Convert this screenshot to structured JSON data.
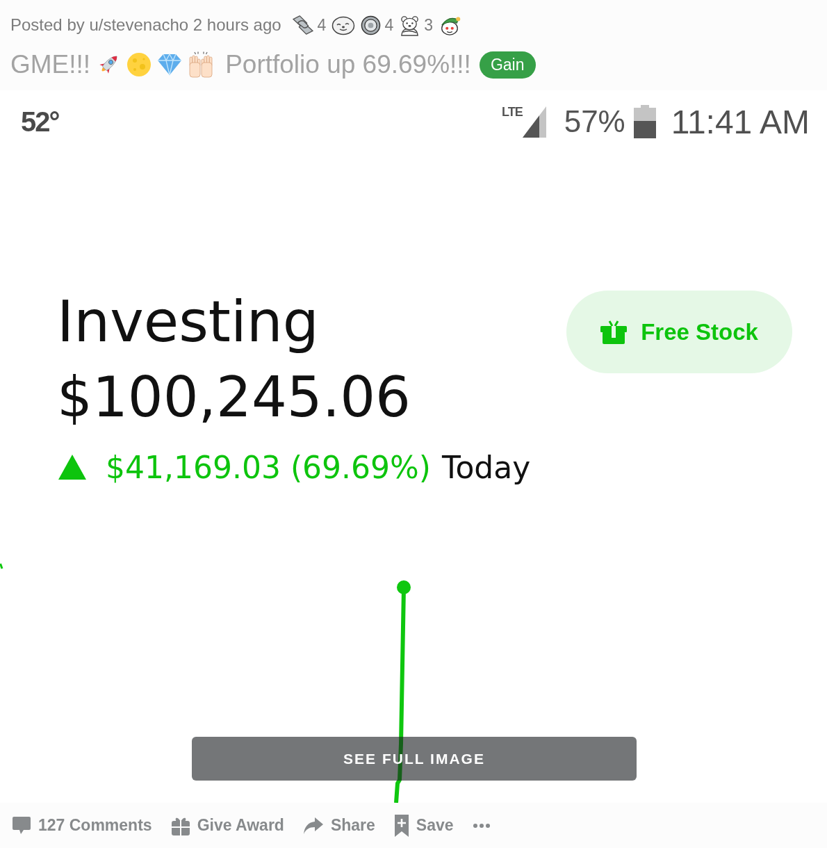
{
  "post": {
    "meta": "Posted by u/stevenacho 2 hours ago",
    "awards": [
      {
        "kind": "handshake",
        "count": "4"
      },
      {
        "kind": "seal"
      },
      {
        "kind": "silver",
        "count": "4"
      },
      {
        "kind": "bear",
        "count": "3"
      },
      {
        "kind": "elf"
      }
    ]
  },
  "title": {
    "lead": "GME!!!",
    "emojis": [
      {
        "kind": "rocket"
      },
      {
        "kind": "moon"
      },
      {
        "kind": "gem"
      },
      {
        "kind": "hands"
      }
    ],
    "text": "Portfolio up 69.69%!!!",
    "flair": "Gain"
  },
  "image": {
    "status_bar": {
      "temperature": "52°",
      "network": "LTE",
      "battery": "57%",
      "time": "11:41 AM"
    },
    "account": {
      "title": "Investing",
      "value": "$100,245.06",
      "change": {
        "kind": "gain",
        "text": "$41,169.03 (69.69%)"
      },
      "period": "Today"
    },
    "promo_button": {
      "label": "Free Stock"
    },
    "overlay_button": {
      "label": "SEE FULL IMAGE"
    }
  },
  "actions": [
    {
      "kind": "comments",
      "label": "127 Comments"
    },
    {
      "kind": "award",
      "label": "Give Award"
    },
    {
      "kind": "share",
      "label": "Share"
    },
    {
      "kind": "save",
      "label": "Save"
    },
    {
      "kind": "more"
    }
  ]
}
